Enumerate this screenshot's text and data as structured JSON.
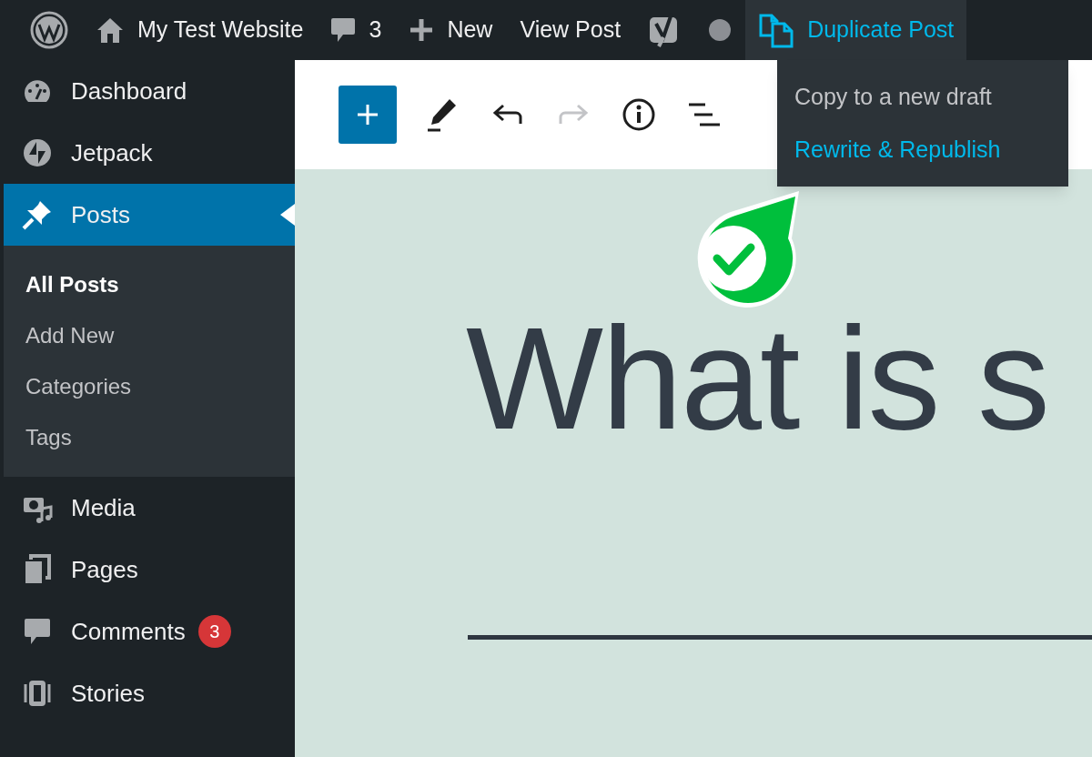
{
  "admin_bar": {
    "items": [
      {
        "kind": "logo"
      },
      {
        "kind": "home",
        "label": "My Test Website"
      },
      {
        "kind": "comments",
        "label": "3"
      },
      {
        "kind": "new",
        "label": "New"
      },
      {
        "kind": "text",
        "label": "View Post"
      },
      {
        "kind": "yoast"
      },
      {
        "kind": "dot"
      },
      {
        "kind": "duplicate",
        "label": "Duplicate Post",
        "expanded": true
      }
    ],
    "dropdown": {
      "items": [
        {
          "label": "Copy to a new draft",
          "selected": false
        },
        {
          "label": "Rewrite & Republish",
          "selected": true
        }
      ]
    }
  },
  "sidebar": {
    "items": [
      {
        "kind": "dashboard",
        "label": "Dashboard",
        "selected": false
      },
      {
        "kind": "jetpack",
        "label": "Jetpack",
        "selected": false
      },
      {
        "kind": "pin",
        "label": "Posts",
        "selected": true,
        "children": [
          {
            "label": "All Posts",
            "selected": true
          },
          {
            "label": "Add New",
            "selected": false
          },
          {
            "label": "Categories",
            "selected": false
          },
          {
            "label": "Tags",
            "selected": false
          }
        ]
      },
      {
        "kind": "media",
        "label": "Media",
        "selected": false
      },
      {
        "kind": "pages",
        "label": "Pages",
        "selected": false
      },
      {
        "kind": "comment",
        "label": "Comments",
        "selected": false,
        "badge": "3"
      },
      {
        "kind": "stories",
        "label": "Stories",
        "selected": false
      }
    ]
  },
  "toolbar": {
    "buttons": [
      {
        "kind": "add",
        "disabled": false
      },
      {
        "kind": "edit",
        "disabled": false
      },
      {
        "kind": "undo",
        "disabled": false
      },
      {
        "kind": "redo",
        "disabled": true
      },
      {
        "kind": "info",
        "disabled": false
      },
      {
        "kind": "outline",
        "disabled": false
      }
    ]
  },
  "editor": {
    "title": "What is s"
  }
}
